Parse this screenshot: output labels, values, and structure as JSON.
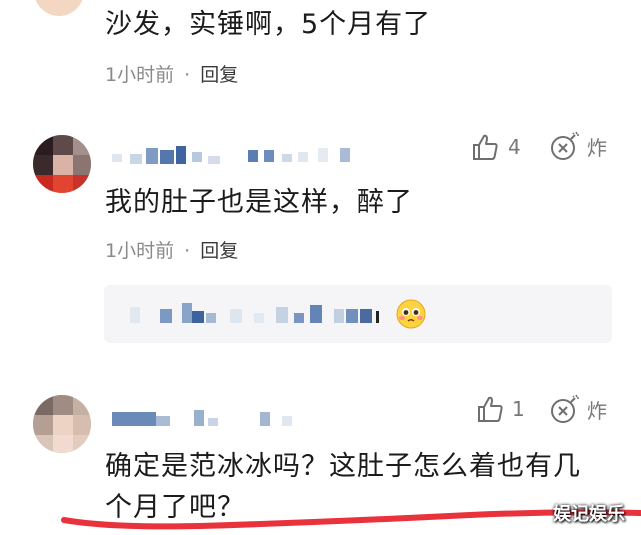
{
  "comments": [
    {
      "text": "沙发，实锤啊，5个月有了",
      "time": "1小时前",
      "separator": "·",
      "reply": "回复"
    },
    {
      "text": "我的肚子也是这样，醉了",
      "time": "1小时前",
      "separator": "·",
      "reply": "回复",
      "likes": "4",
      "bomb_label": "炸"
    },
    {
      "text_line1": "确定是范冰冰吗？这肚子怎么着也有几",
      "text_line2": "个月了吧？",
      "likes": "1",
      "bomb_label": "炸"
    }
  ],
  "watermark": "娱记娱乐",
  "colors": {
    "underline": "#e8323c",
    "icon_gray": "#6f6f6f",
    "reply_box_bg": "#f5f5f7"
  },
  "icons": [
    "thumbs-up-icon",
    "bomb-icon",
    "emoji-icon"
  ]
}
